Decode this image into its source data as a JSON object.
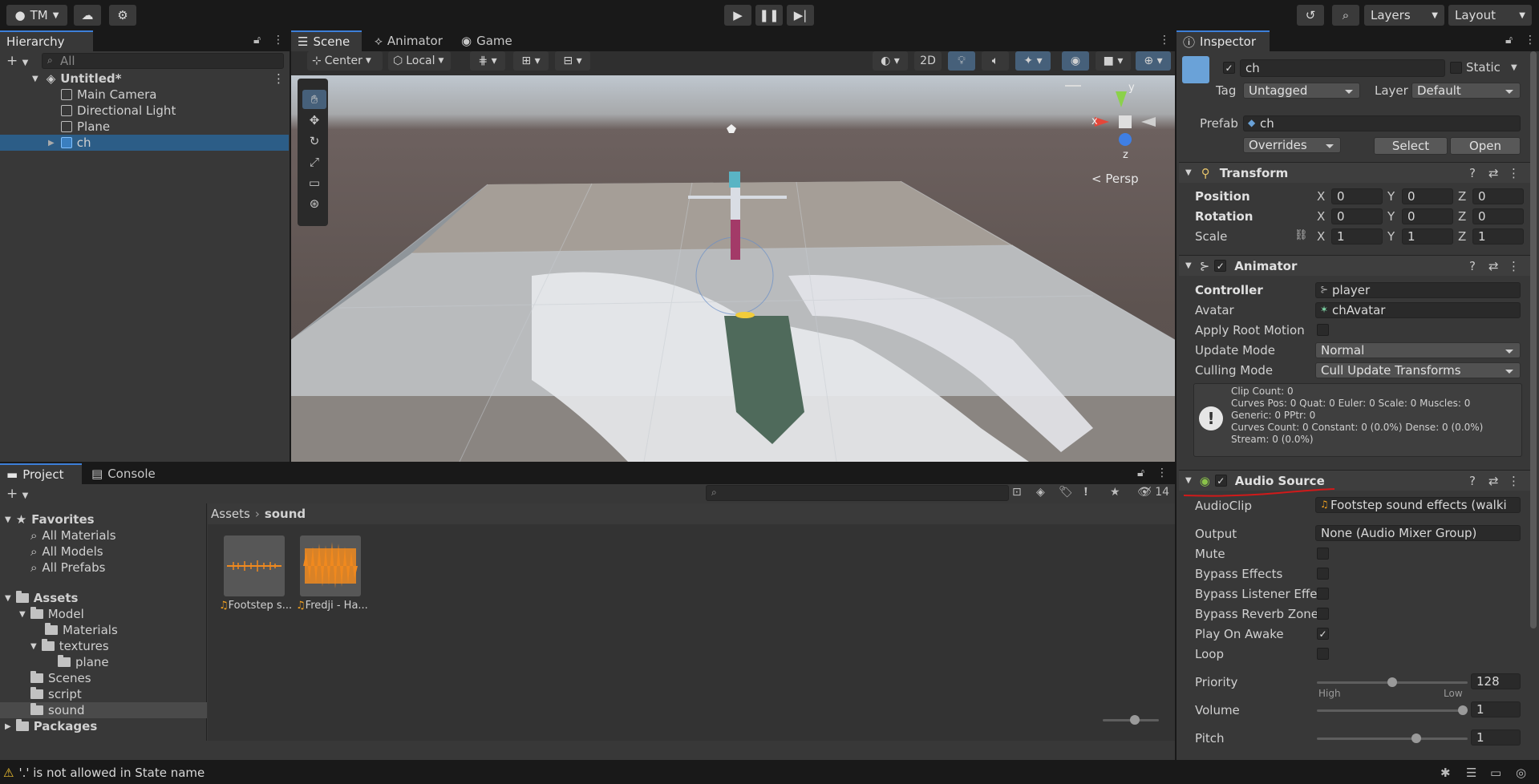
{
  "toolbar": {
    "account_label": "TM",
    "layers_label": "Layers",
    "layout_label": "Layout"
  },
  "hierarchy": {
    "tab": "Hierarchy",
    "search_placeholder": "All",
    "scene": "Untitled*",
    "items": [
      {
        "label": "Main Camera"
      },
      {
        "label": "Directional Light"
      },
      {
        "label": "Plane"
      },
      {
        "label": "ch"
      }
    ]
  },
  "scene_tabs": {
    "scene": "Scene",
    "animator": "Animator",
    "game": "Game"
  },
  "scene_toolbar": {
    "pivot": "Center",
    "space": "Local",
    "mode_2d": "2D",
    "persp": "Persp",
    "gizmo_x": "x",
    "gizmo_y": "y",
    "gizmo_z": "z"
  },
  "project": {
    "tab_project": "Project",
    "tab_console": "Console",
    "favorites": "Favorites",
    "fav_items": [
      "All Materials",
      "All Models",
      "All Prefabs"
    ],
    "assets": "Assets",
    "tree": [
      {
        "label": "Model",
        "depth": 1
      },
      {
        "label": "Materials",
        "depth": 2
      },
      {
        "label": "textures",
        "depth": 2
      },
      {
        "label": "plane",
        "depth": 3
      },
      {
        "label": "Scenes",
        "depth": 1
      },
      {
        "label": "script",
        "depth": 1
      },
      {
        "label": "sound",
        "depth": 1
      }
    ],
    "packages": "Packages",
    "breadcrumb_root": "Assets",
    "breadcrumb_current": "sound",
    "hidden_count": "14",
    "files": [
      {
        "label": "Footstep s..."
      },
      {
        "label": "Fredji - Ha..."
      }
    ]
  },
  "inspector": {
    "tab": "Inspector",
    "object_name": "ch",
    "static_label": "Static",
    "tag_label": "Tag",
    "tag_value": "Untagged",
    "layer_label": "Layer",
    "layer_value": "Default",
    "prefab_label": "Prefab",
    "prefab_value": "ch",
    "overrides": "Overrides",
    "select": "Select",
    "open": "Open",
    "transform": {
      "title": "Transform",
      "position": "Position",
      "rotation": "Rotation",
      "scale": "Scale",
      "pos": [
        "0",
        "0",
        "0"
      ],
      "rot": [
        "0",
        "0",
        "0"
      ],
      "scl": [
        "1",
        "1",
        "1"
      ]
    },
    "animator": {
      "title": "Animator",
      "controller_label": "Controller",
      "controller_value": "player",
      "avatar_label": "Avatar",
      "avatar_value": "chAvatar",
      "apply_root_motion": "Apply Root Motion",
      "update_mode_label": "Update Mode",
      "update_mode_value": "Normal",
      "culling_mode_label": "Culling Mode",
      "culling_mode_value": "Cull Update Transforms",
      "info": [
        "Clip Count: 0",
        "Curves Pos: 0 Quat: 0 Euler: 0 Scale: 0 Muscles: 0",
        "Generic: 0 PPtr: 0",
        "Curves Count: 0 Constant: 0 (0.0%) Dense: 0 (0.0%)",
        "Stream: 0 (0.0%)"
      ]
    },
    "audio": {
      "title": "Audio Source",
      "clip_label": "AudioClip",
      "clip_value": "Footstep sound effects (walki",
      "output_label": "Output",
      "output_value": "None (Audio Mixer Group)",
      "mute": "Mute",
      "bypass_effects": "Bypass Effects",
      "bypass_listener": "Bypass Listener Effe",
      "bypass_reverb": "Bypass Reverb Zone",
      "play_on_awake": "Play On Awake",
      "loop": "Loop",
      "priority_label": "Priority",
      "priority_value": "128",
      "priority_fraction": 0.5,
      "high": "High",
      "low": "Low",
      "volume_label": "Volume",
      "volume_value": "1",
      "volume_fraction": 1.0,
      "pitch_label": "Pitch",
      "pitch_value": "1",
      "pitch_fraction": 0.67
    }
  },
  "status": {
    "message": "'.' is not allowed in State name"
  },
  "colors": {
    "accent": "#3d7fd8",
    "selection": "#2c5d87",
    "warning": "#f4c430",
    "annotation_red": "#d01a1a"
  }
}
